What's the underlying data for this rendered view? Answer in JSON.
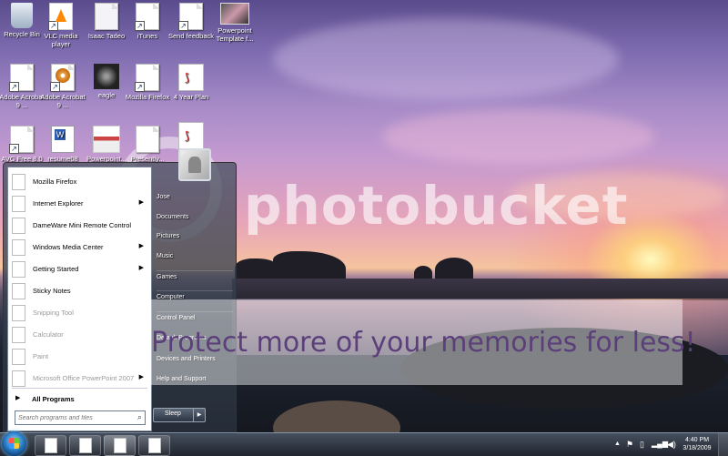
{
  "desktop_icons": [
    {
      "label": "Recycle Bin"
    },
    {
      "label": "VLC media player"
    },
    {
      "label": "Isaac Tadeo"
    },
    {
      "label": "iTunes"
    },
    {
      "label": "Send feedback"
    },
    {
      "label": "Powerpoint Template f..."
    },
    {
      "label": "Adobe Acrobat 9 ..."
    },
    {
      "label": "Adobe Acrobat 9 ..."
    },
    {
      "label": "eagle"
    },
    {
      "label": "Mozilla Firefox"
    },
    {
      "label": "4 Year Plan"
    },
    {
      "label": "AVG Free 8.0"
    },
    {
      "label": "resume08"
    },
    {
      "label": "Powerpoint..."
    },
    {
      "label": "Presently..."
    }
  ],
  "watermark": {
    "logo": "photobucket",
    "banner": "Protect more of your memories for less!"
  },
  "start_menu": {
    "programs": [
      {
        "label": "Mozilla Firefox",
        "arrow": ""
      },
      {
        "label": "Internet Explorer",
        "arrow": "▶"
      },
      {
        "label": "DameWare Mini Remote Control",
        "arrow": ""
      },
      {
        "label": "Windows Media Center",
        "arrow": "▶"
      },
      {
        "label": "Getting Started",
        "arrow": "▶"
      },
      {
        "label": "Sticky Notes",
        "arrow": ""
      },
      {
        "label": "Snipping Tool",
        "arrow": ""
      },
      {
        "label": "Calculator",
        "arrow": ""
      },
      {
        "label": "Paint",
        "arrow": ""
      },
      {
        "label": "Microsoft Office PowerPoint 2007",
        "arrow": "▶"
      }
    ],
    "all_programs": "All Programs",
    "all_programs_arrow": "▶",
    "search_placeholder": "Search programs and files",
    "right_items": [
      "Jose",
      "Documents",
      "Pictures",
      "Music",
      "Games",
      "Computer",
      "Control Panel",
      "Default Programs",
      "Devices and Printers",
      "Help and Support"
    ],
    "sleep_label": "Sleep",
    "sleep_arrow": "▶"
  },
  "taskbar": {
    "time": "4:40 PM",
    "date": "3/18/2009",
    "tray_icons": [
      "up-arrow-icon",
      "flag-icon",
      "battery-icon",
      "signal-icon",
      "speaker-icon"
    ]
  }
}
